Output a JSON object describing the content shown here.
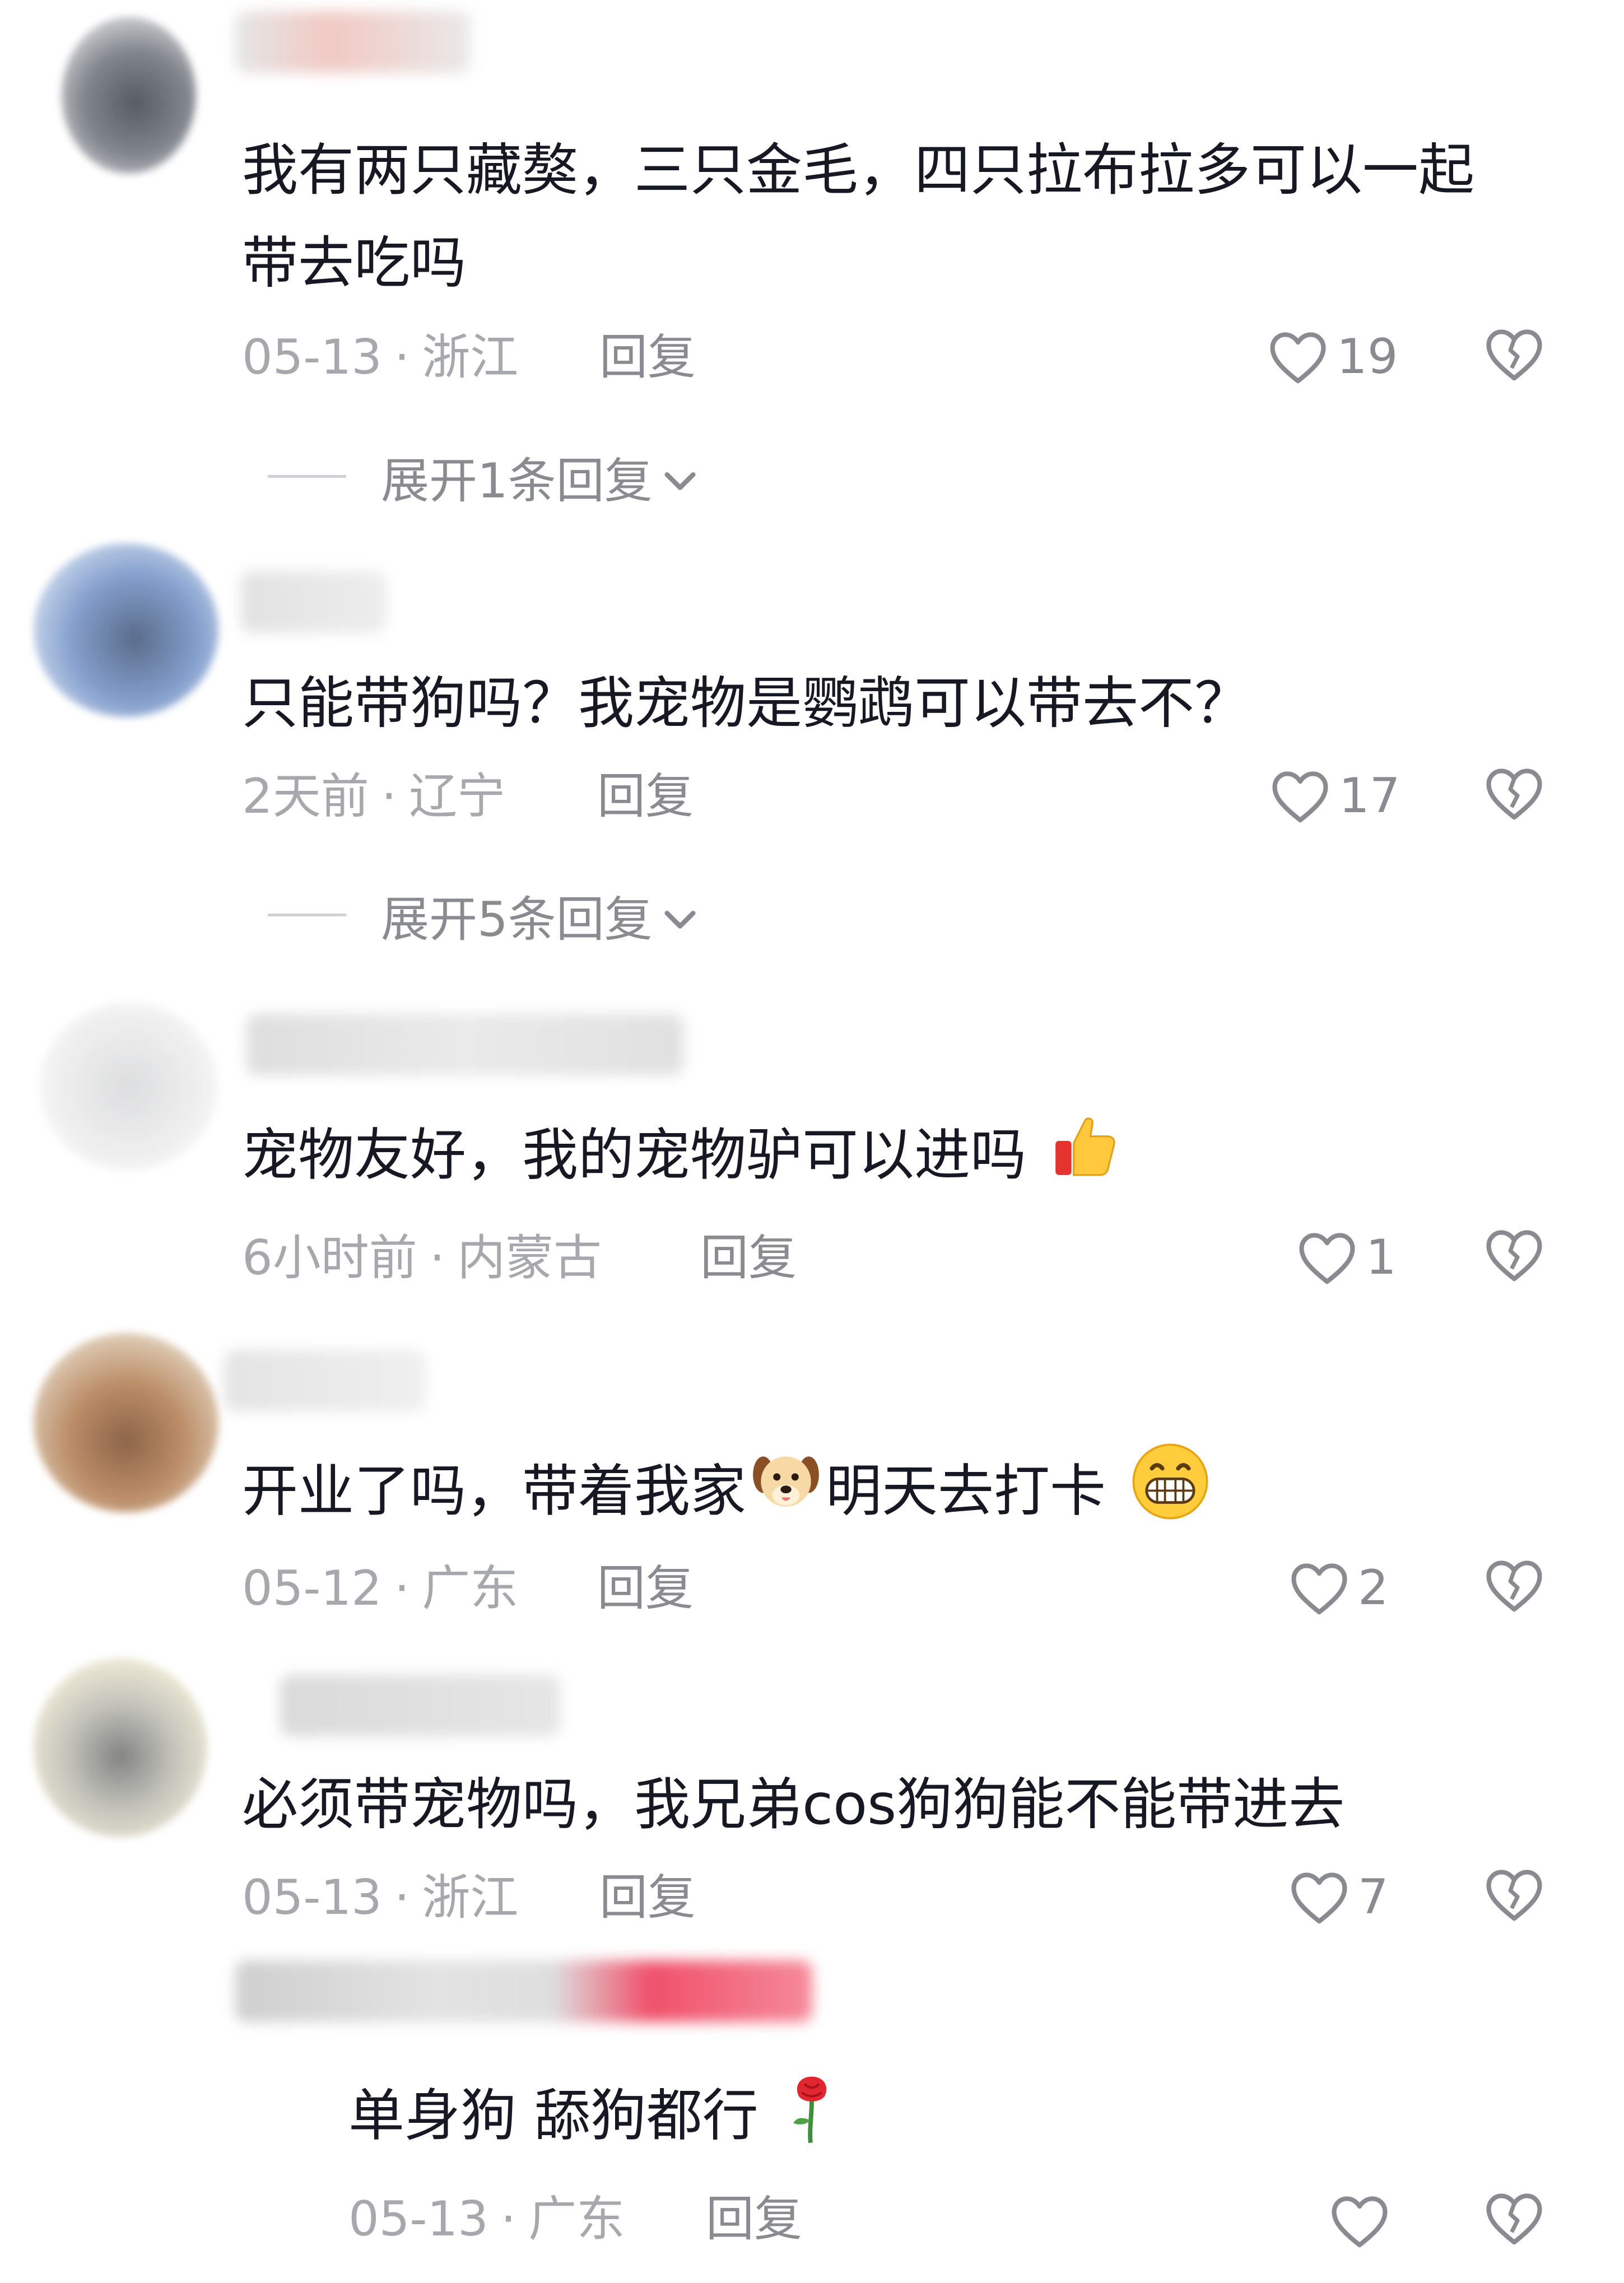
{
  "comments": [
    {
      "text_line1": "我有两只藏獒，三只金毛，四只拉布拉多可以一起",
      "text_line2": "带去吃吗",
      "date": "05-13",
      "location": "浙江",
      "reply_label": "回复",
      "likes": "19",
      "expand_label": "展开1条回复"
    },
    {
      "text": "只能带狗吗？我宠物是鹦鹉可以带去不？",
      "date": "2天前",
      "location": "辽宁",
      "reply_label": "回复",
      "likes": "17",
      "expand_label": "展开5条回复"
    },
    {
      "text": "宠物友好，我的宠物驴可以进吗",
      "emoji": "thumbs-up",
      "date": "6小时前",
      "location": "内蒙古",
      "reply_label": "回复",
      "likes": "1"
    },
    {
      "text_before": "开业了吗，带着我家",
      "emoji_mid": "dog-face",
      "text_after": "明天去打卡",
      "emoji_end": "grinning-face",
      "date": "05-12",
      "location": "广东",
      "reply_label": "回复",
      "likes": "2"
    },
    {
      "text": "必须带宠物吗，我兄弟cos狗狗能不能带进去",
      "date": "05-13",
      "location": "浙江",
      "reply_label": "回复",
      "likes": "7"
    }
  ],
  "sub_reply": {
    "text": "单身狗 舔狗都行",
    "emoji": "rose",
    "date": "05-13",
    "location": "广东",
    "reply_label": "回复"
  },
  "colors": {
    "text": "#161823",
    "meta": "#a7a8ad",
    "action": "#8a8b91",
    "highlight_blur": "#f0506a"
  },
  "icons": [
    "heart-icon",
    "broken-heart-icon",
    "chevron-down-icon"
  ]
}
